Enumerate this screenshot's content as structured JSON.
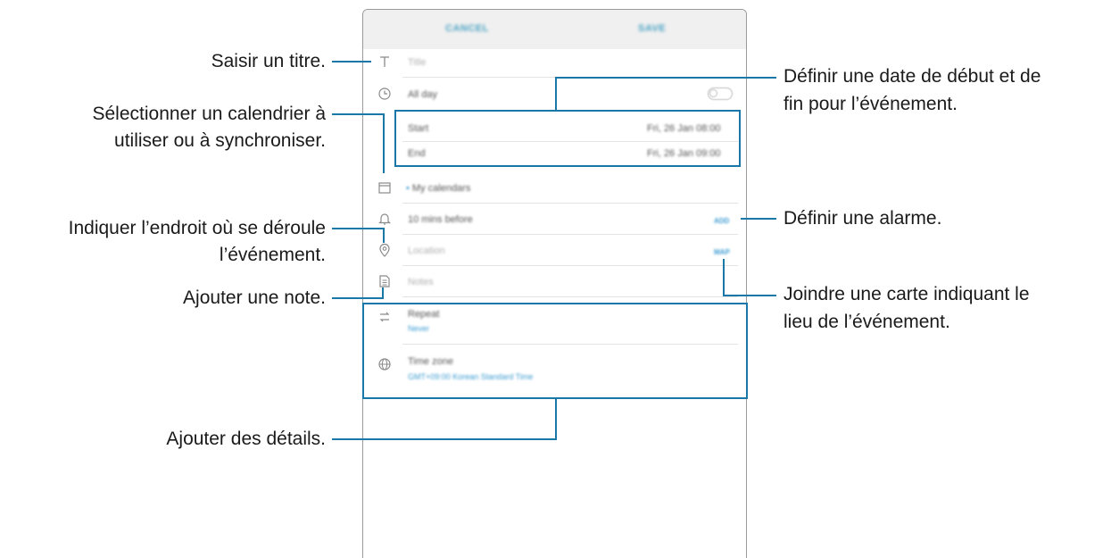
{
  "screen": {
    "topbar": {
      "cancel_label": "CANCEL",
      "save_label": "SAVE"
    },
    "title_placeholder": "Title",
    "all_day_label": "All day",
    "start_label": "Start",
    "start_value": "Fri, 26 Jan   08:00",
    "end_label": "End",
    "end_value": "Fri, 26 Jan   09:00",
    "calendar_label": "My calendars",
    "alarm_label": "10 mins before",
    "alarm_action": "ADD",
    "location_placeholder": "Location",
    "map_action": "MAP",
    "notes_placeholder": "Notes",
    "repeat_label": "Repeat",
    "repeat_value": "Never",
    "timezone_label": "Time zone",
    "timezone_value": "GMT+09:00 Korean Standard Time"
  },
  "callouts": {
    "title": "Saisir un titre.",
    "calendar": [
      "Sélectionner un calendrier à",
      "utiliser ou à synchroniser."
    ],
    "location": [
      "Indiquer l’endroit où se déroule",
      "l’événement."
    ],
    "note": "Ajouter une note.",
    "details": "Ajouter des détails.",
    "date": [
      "Définir une date de début et de",
      "fin pour l’événement."
    ],
    "alarm": "Définir une alarme.",
    "map": [
      "Joindre une carte indiquant le",
      "lieu de l’événement."
    ]
  },
  "colors": {
    "callout_line": "#1a78a8",
    "accent": "#3b9bd0"
  }
}
